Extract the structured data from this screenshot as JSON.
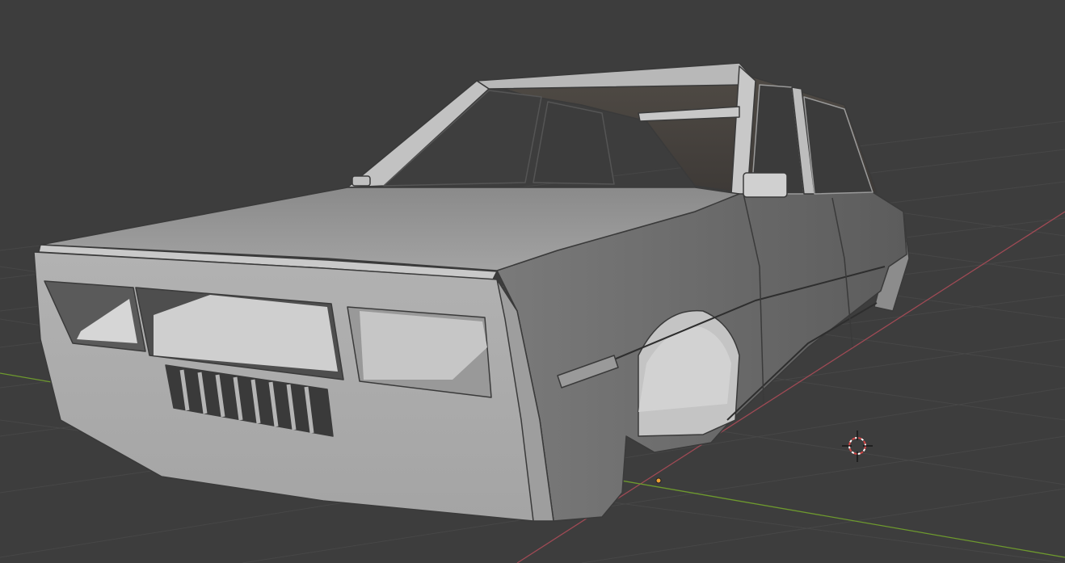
{
  "viewport": {
    "background": "#3d3d3d",
    "grid_color": "#474747",
    "x_axis_color": "#a04a55",
    "y_axis_color": "#6e9a2e",
    "cursor_color": "#d24444"
  },
  "object": {
    "name": "car body mesh",
    "shading": "solid"
  }
}
